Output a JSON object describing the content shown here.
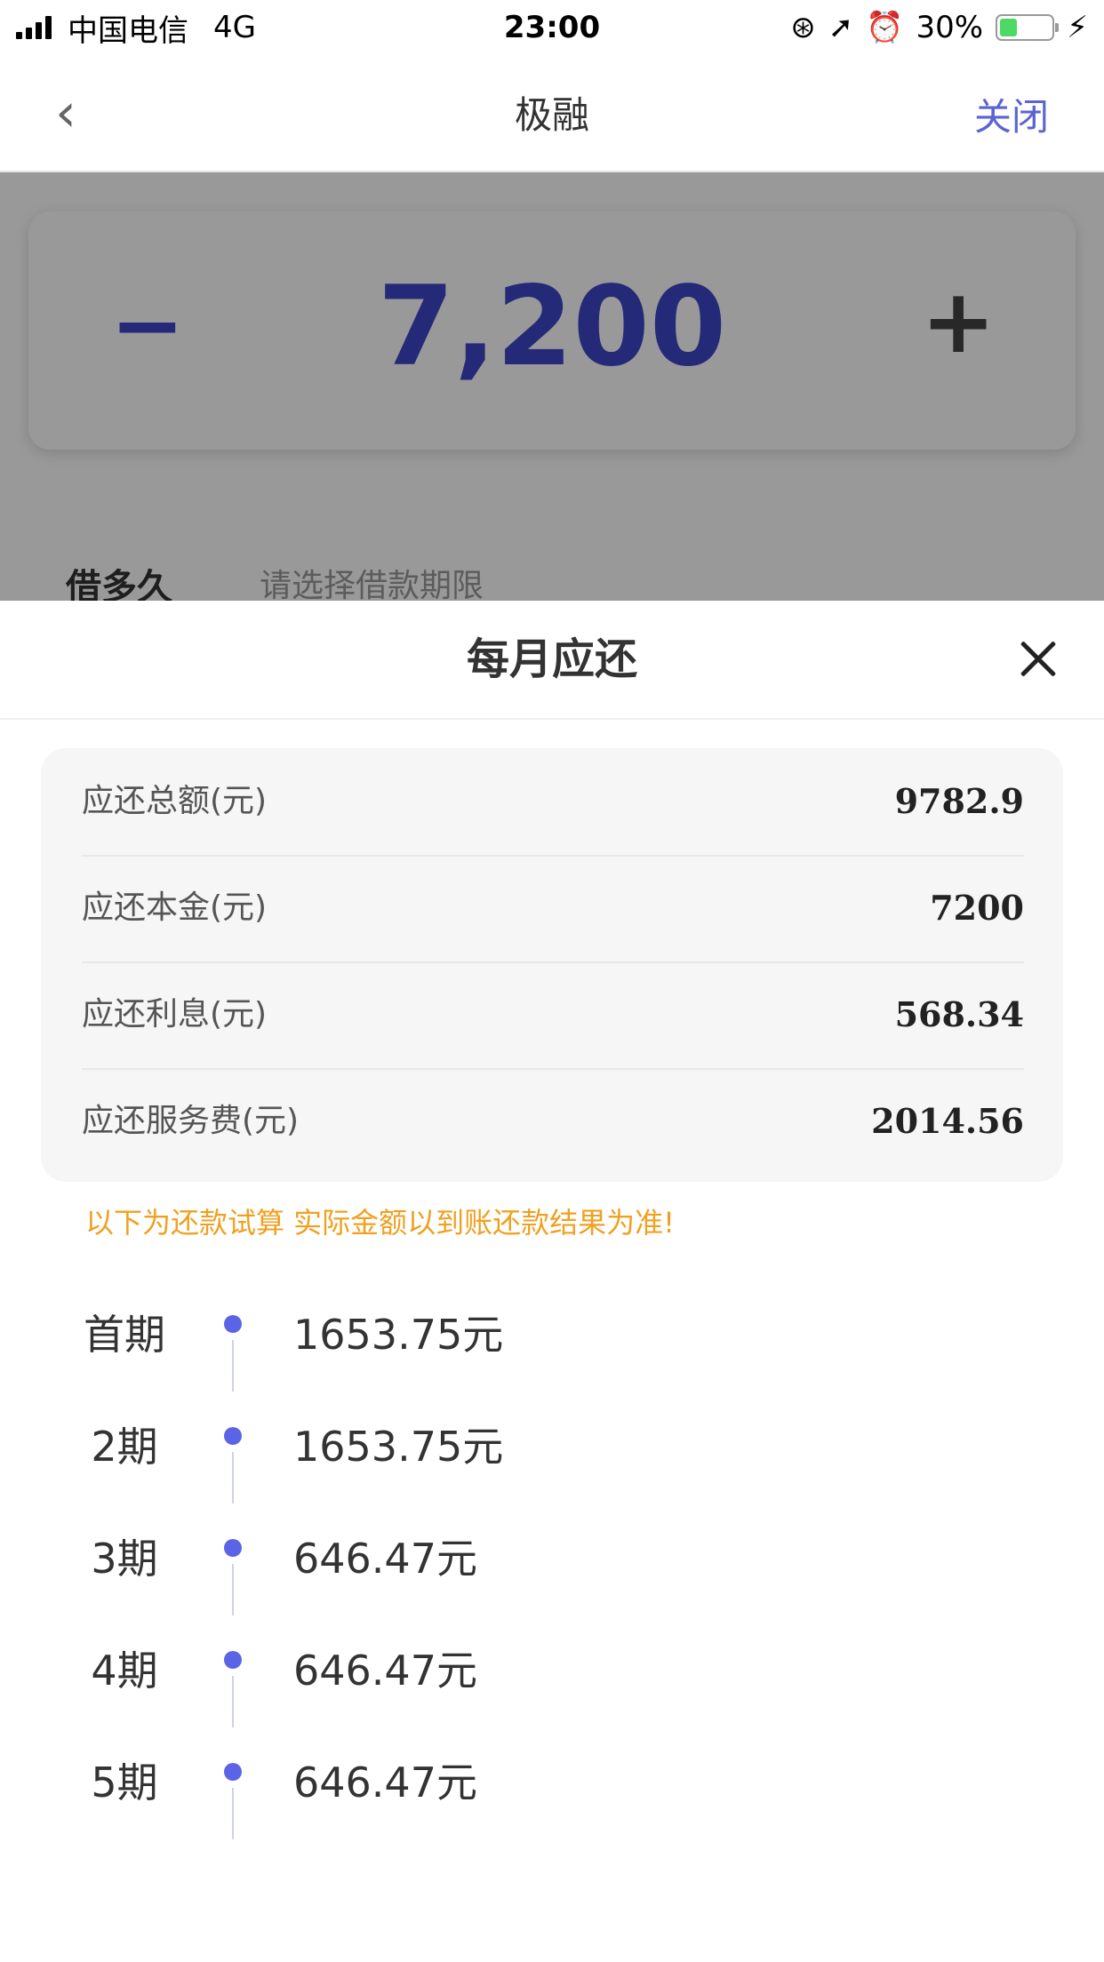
{
  "status_bar": {
    "carrier": "中国电信",
    "network": "4G",
    "time": "23:00",
    "battery_text": "30%",
    "battery_level": 0.3
  },
  "nav": {
    "title": "极融",
    "close_label": "关闭"
  },
  "amount": {
    "minus": "−",
    "value": "7,200",
    "plus": "+",
    "accent_color": "#3e46c8"
  },
  "term": {
    "label": "借多久",
    "placeholder": "请选择借款期限"
  },
  "sheet": {
    "title": "每月应还",
    "summary": [
      {
        "label": "应还总额(元)",
        "value": "9782.9"
      },
      {
        "label": "应还本金(元)",
        "value": "7200"
      },
      {
        "label": "应还利息(元)",
        "value": "568.34"
      },
      {
        "label": "应还服务费(元)",
        "value": "2014.56"
      }
    ],
    "notice": "以下为还款试算 实际金额以到账还款结果为准!",
    "notice_color": "#f0a020",
    "plan": [
      {
        "period": "首期",
        "amount": "1653.75元"
      },
      {
        "period": "2期",
        "amount": "1653.75元"
      },
      {
        "period": "3期",
        "amount": "646.47元"
      },
      {
        "period": "4期",
        "amount": "646.47元"
      },
      {
        "period": "5期",
        "amount": "646.47元"
      }
    ]
  }
}
